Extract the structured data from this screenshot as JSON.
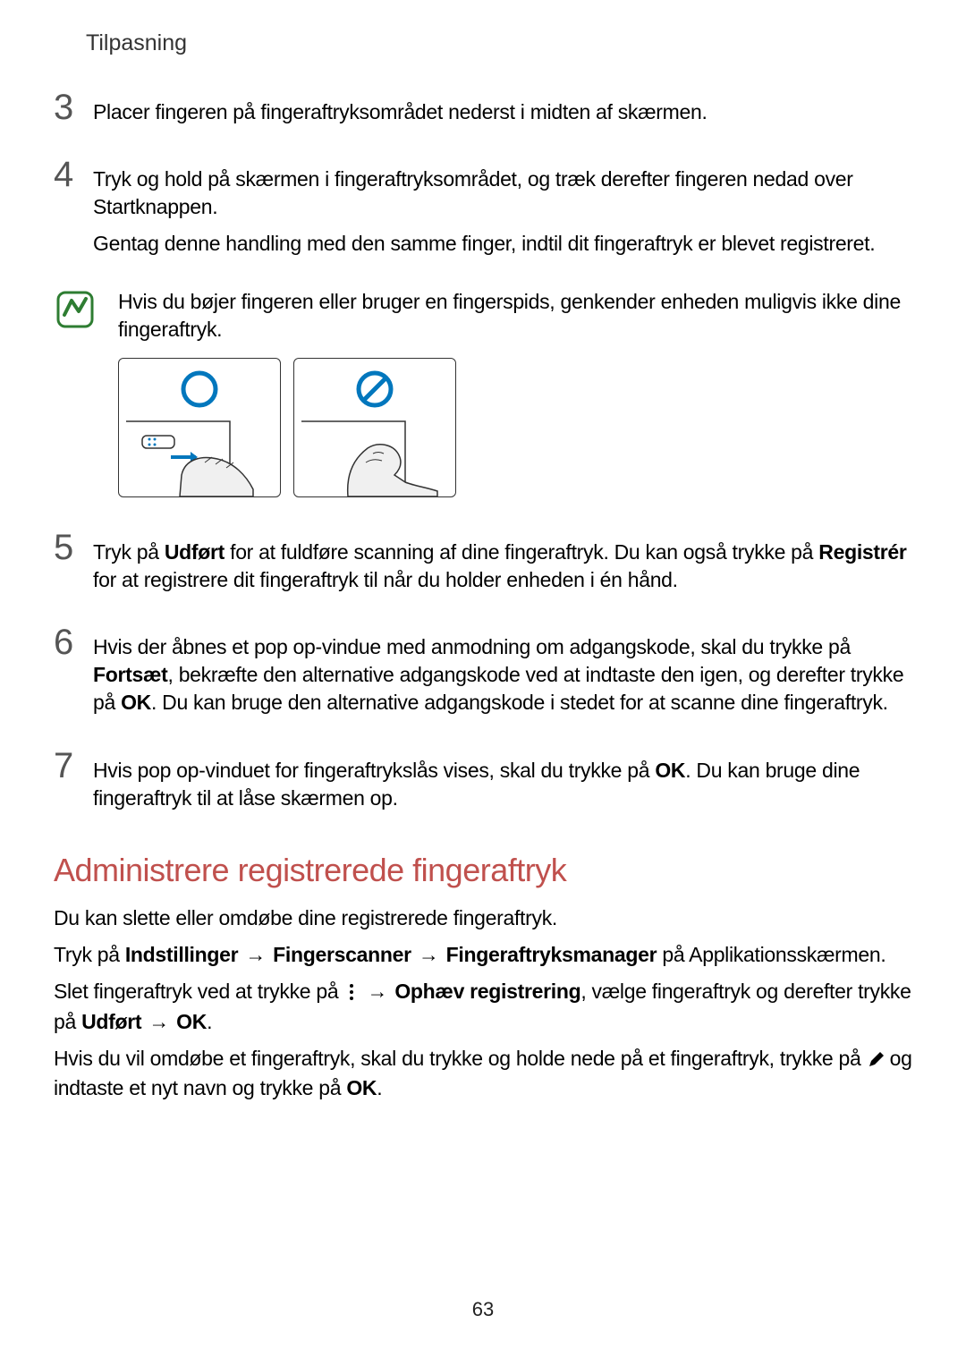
{
  "header": "Tilpasning",
  "steps": [
    {
      "num": "3",
      "lines": [
        "Placer fingeren på fingeraftryksområdet nederst i midten af skærmen."
      ]
    },
    {
      "num": "4",
      "lines": [
        "Tryk og hold på skærmen i fingeraftryksområdet, og træk derefter fingeren nedad over Startknappen.",
        "Gentag denne handling med den samme finger, indtil dit fingeraftryk er blevet registreret."
      ]
    },
    {
      "num": "5",
      "lines_pre": "Tryk på ",
      "bold1": "Udført",
      "mid1": " for at fuldføre scanning af dine fingeraftryk. Du kan også trykke på ",
      "bold2": "Registrér",
      "post1": " for at registrere dit fingeraftryk til når du holder enheden i én hånd."
    },
    {
      "num": "6",
      "lines_pre": "Hvis der åbnes et pop op-vindue med anmodning om adgangskode, skal du trykke på ",
      "bold1": "Fortsæt",
      "mid1": ", bekræfte den alternative adgangskode ved at indtaste den igen, og derefter trykke på ",
      "bold2": "OK",
      "post1": ". Du kan bruge den alternative adgangskode i stedet for at scanne dine fingeraftryk."
    },
    {
      "num": "7",
      "lines_pre": "Hvis pop op-vinduet for fingeraftrykslås vises, skal du trykke på ",
      "bold1": "OK",
      "post1": ". Du kan bruge dine fingeraftryk til at låse skærmen op."
    }
  ],
  "info_text": "Hvis du bøjer fingeren eller bruger en fingerspids, genkender enheden muligvis ikke dine fingeraftryk.",
  "section_title": "Administrere registrerede fingeraftryk",
  "manage": {
    "p1": "Du kan slette eller omdøbe dine registrerede fingeraftryk.",
    "p2_pre": "Tryk på ",
    "p2_b1": "Indstillinger",
    "p2_arrow1": " → ",
    "p2_b2": "Fingerscanner",
    "p2_arrow2": " → ",
    "p2_b3": "Fingeraftryksmanager",
    "p2_post": " på Applikationsskærmen.",
    "p3_pre": "Slet fingeraftryk ved at trykke på ",
    "p3_arrow": " → ",
    "p3_b1": "Ophæv registrering",
    "p3_mid": ", vælge fingeraftryk og derefter trykke på ",
    "p3_b2": "Udført",
    "p3_arrow2": " → ",
    "p3_b3": "OK",
    "p3_post": ".",
    "p4_pre": "Hvis du vil omdøbe et fingeraftryk, skal du trykke og holde nede på et fingeraftryk, trykke på ",
    "p4_mid": " og indtaste et nyt navn og trykke på ",
    "p4_b1": "OK",
    "p4_post": "."
  },
  "page_number": "63"
}
